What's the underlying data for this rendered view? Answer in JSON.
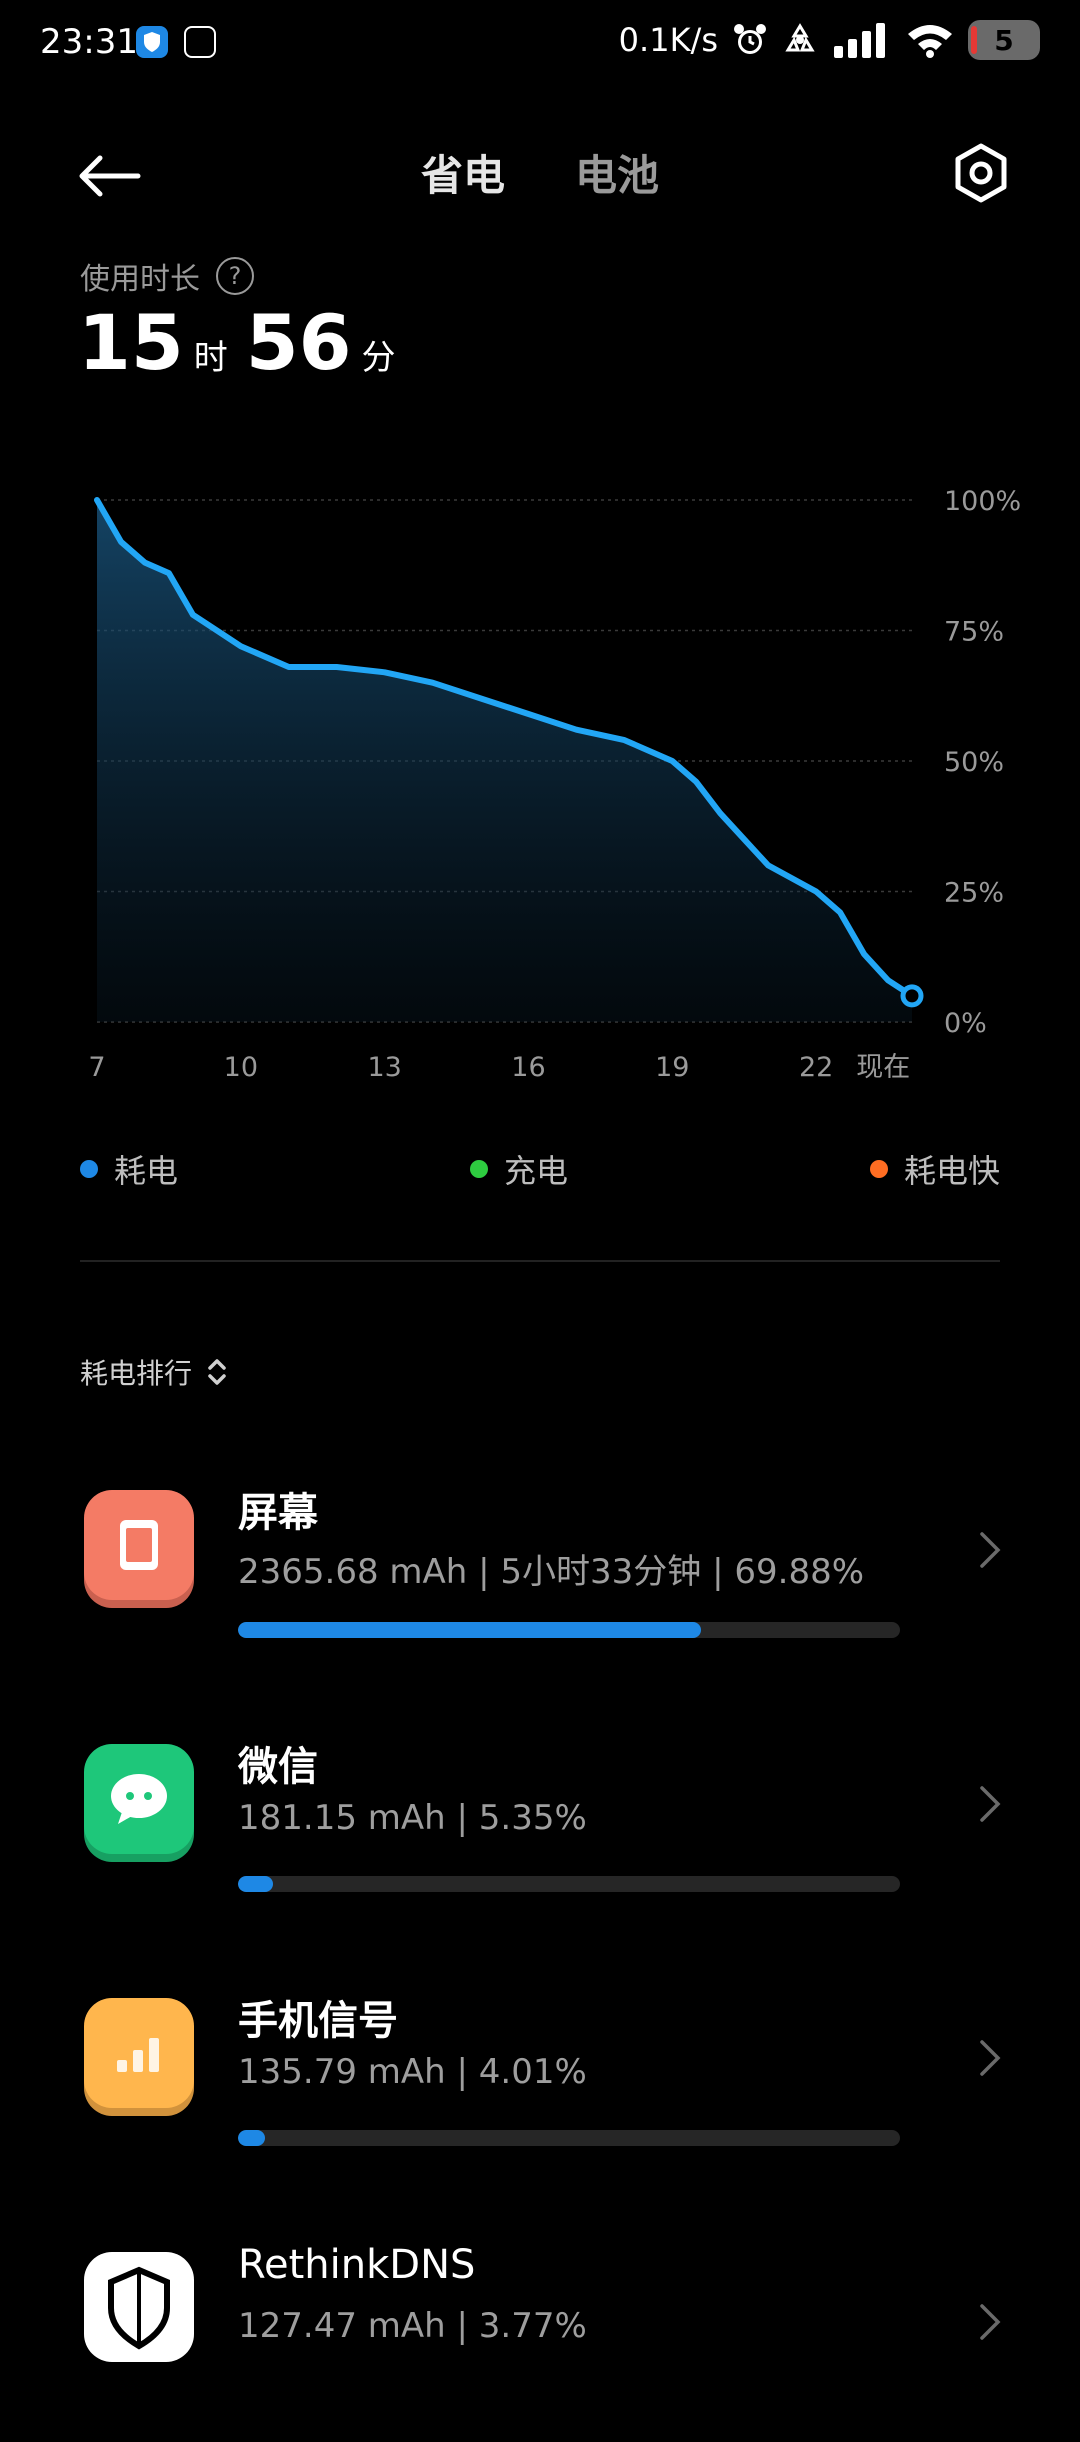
{
  "status_bar": {
    "time": "23:31",
    "net_speed": "0.1K/s",
    "battery_level": "5"
  },
  "header": {
    "tabs": [
      {
        "label": "省电",
        "active": true
      },
      {
        "label": "电池",
        "active": false
      }
    ]
  },
  "usage": {
    "label": "使用时长",
    "hours": "15",
    "hours_unit": "时",
    "minutes": "56",
    "minutes_unit": "分"
  },
  "chart_data": {
    "type": "area",
    "x_tick_labels": [
      "7",
      "10",
      "13",
      "16",
      "19",
      "22",
      "现在"
    ],
    "y_tick_labels": [
      "100%",
      "75%",
      "50%",
      "25%",
      "0%"
    ],
    "ylim": [
      0,
      100
    ],
    "xlim": [
      7,
      24
    ],
    "series": [
      {
        "name": "耗电",
        "x": [
          7,
          7.5,
          8,
          8.5,
          9,
          9.5,
          10,
          11,
          12,
          13,
          14,
          15,
          16,
          17,
          18,
          19,
          19.5,
          20,
          20.5,
          21,
          22,
          22.5,
          23,
          23.5,
          24
        ],
        "y": [
          100,
          92,
          88,
          86,
          78,
          75,
          72,
          68,
          68,
          67,
          65,
          62,
          59,
          56,
          54,
          50,
          46,
          40,
          35,
          30,
          25,
          21,
          13,
          8,
          5
        ]
      }
    ],
    "grid": true,
    "line_color": "#22a6f5"
  },
  "legend": [
    {
      "label": "耗电",
      "color": "#1e88e5"
    },
    {
      "label": "充电",
      "color": "#2ecc40"
    },
    {
      "label": "耗电快",
      "color": "#ff6d22"
    }
  ],
  "ranking": {
    "label": "耗电排行"
  },
  "items": [
    {
      "name": "屏幕",
      "detail": "2365.68 mAh | 5小时33分钟 | 69.88%",
      "percent": 69.88,
      "icon": "screen-icon",
      "icon_color": "#f47b65"
    },
    {
      "name": "微信",
      "detail": "181.15 mAh | 5.35%",
      "percent": 5.35,
      "icon": "wechat-icon",
      "icon_color": "#1ec77a"
    },
    {
      "name": "手机信号",
      "detail": "135.79 mAh | 4.01%",
      "percent": 4.01,
      "icon": "signal-icon",
      "icon_color": "#ffb64d"
    },
    {
      "name": "RethinkDNS",
      "detail": "127.47 mAh | 3.77%",
      "percent": 3.77,
      "icon": "dns-shield-icon",
      "icon_color": "#ffffff"
    }
  ]
}
